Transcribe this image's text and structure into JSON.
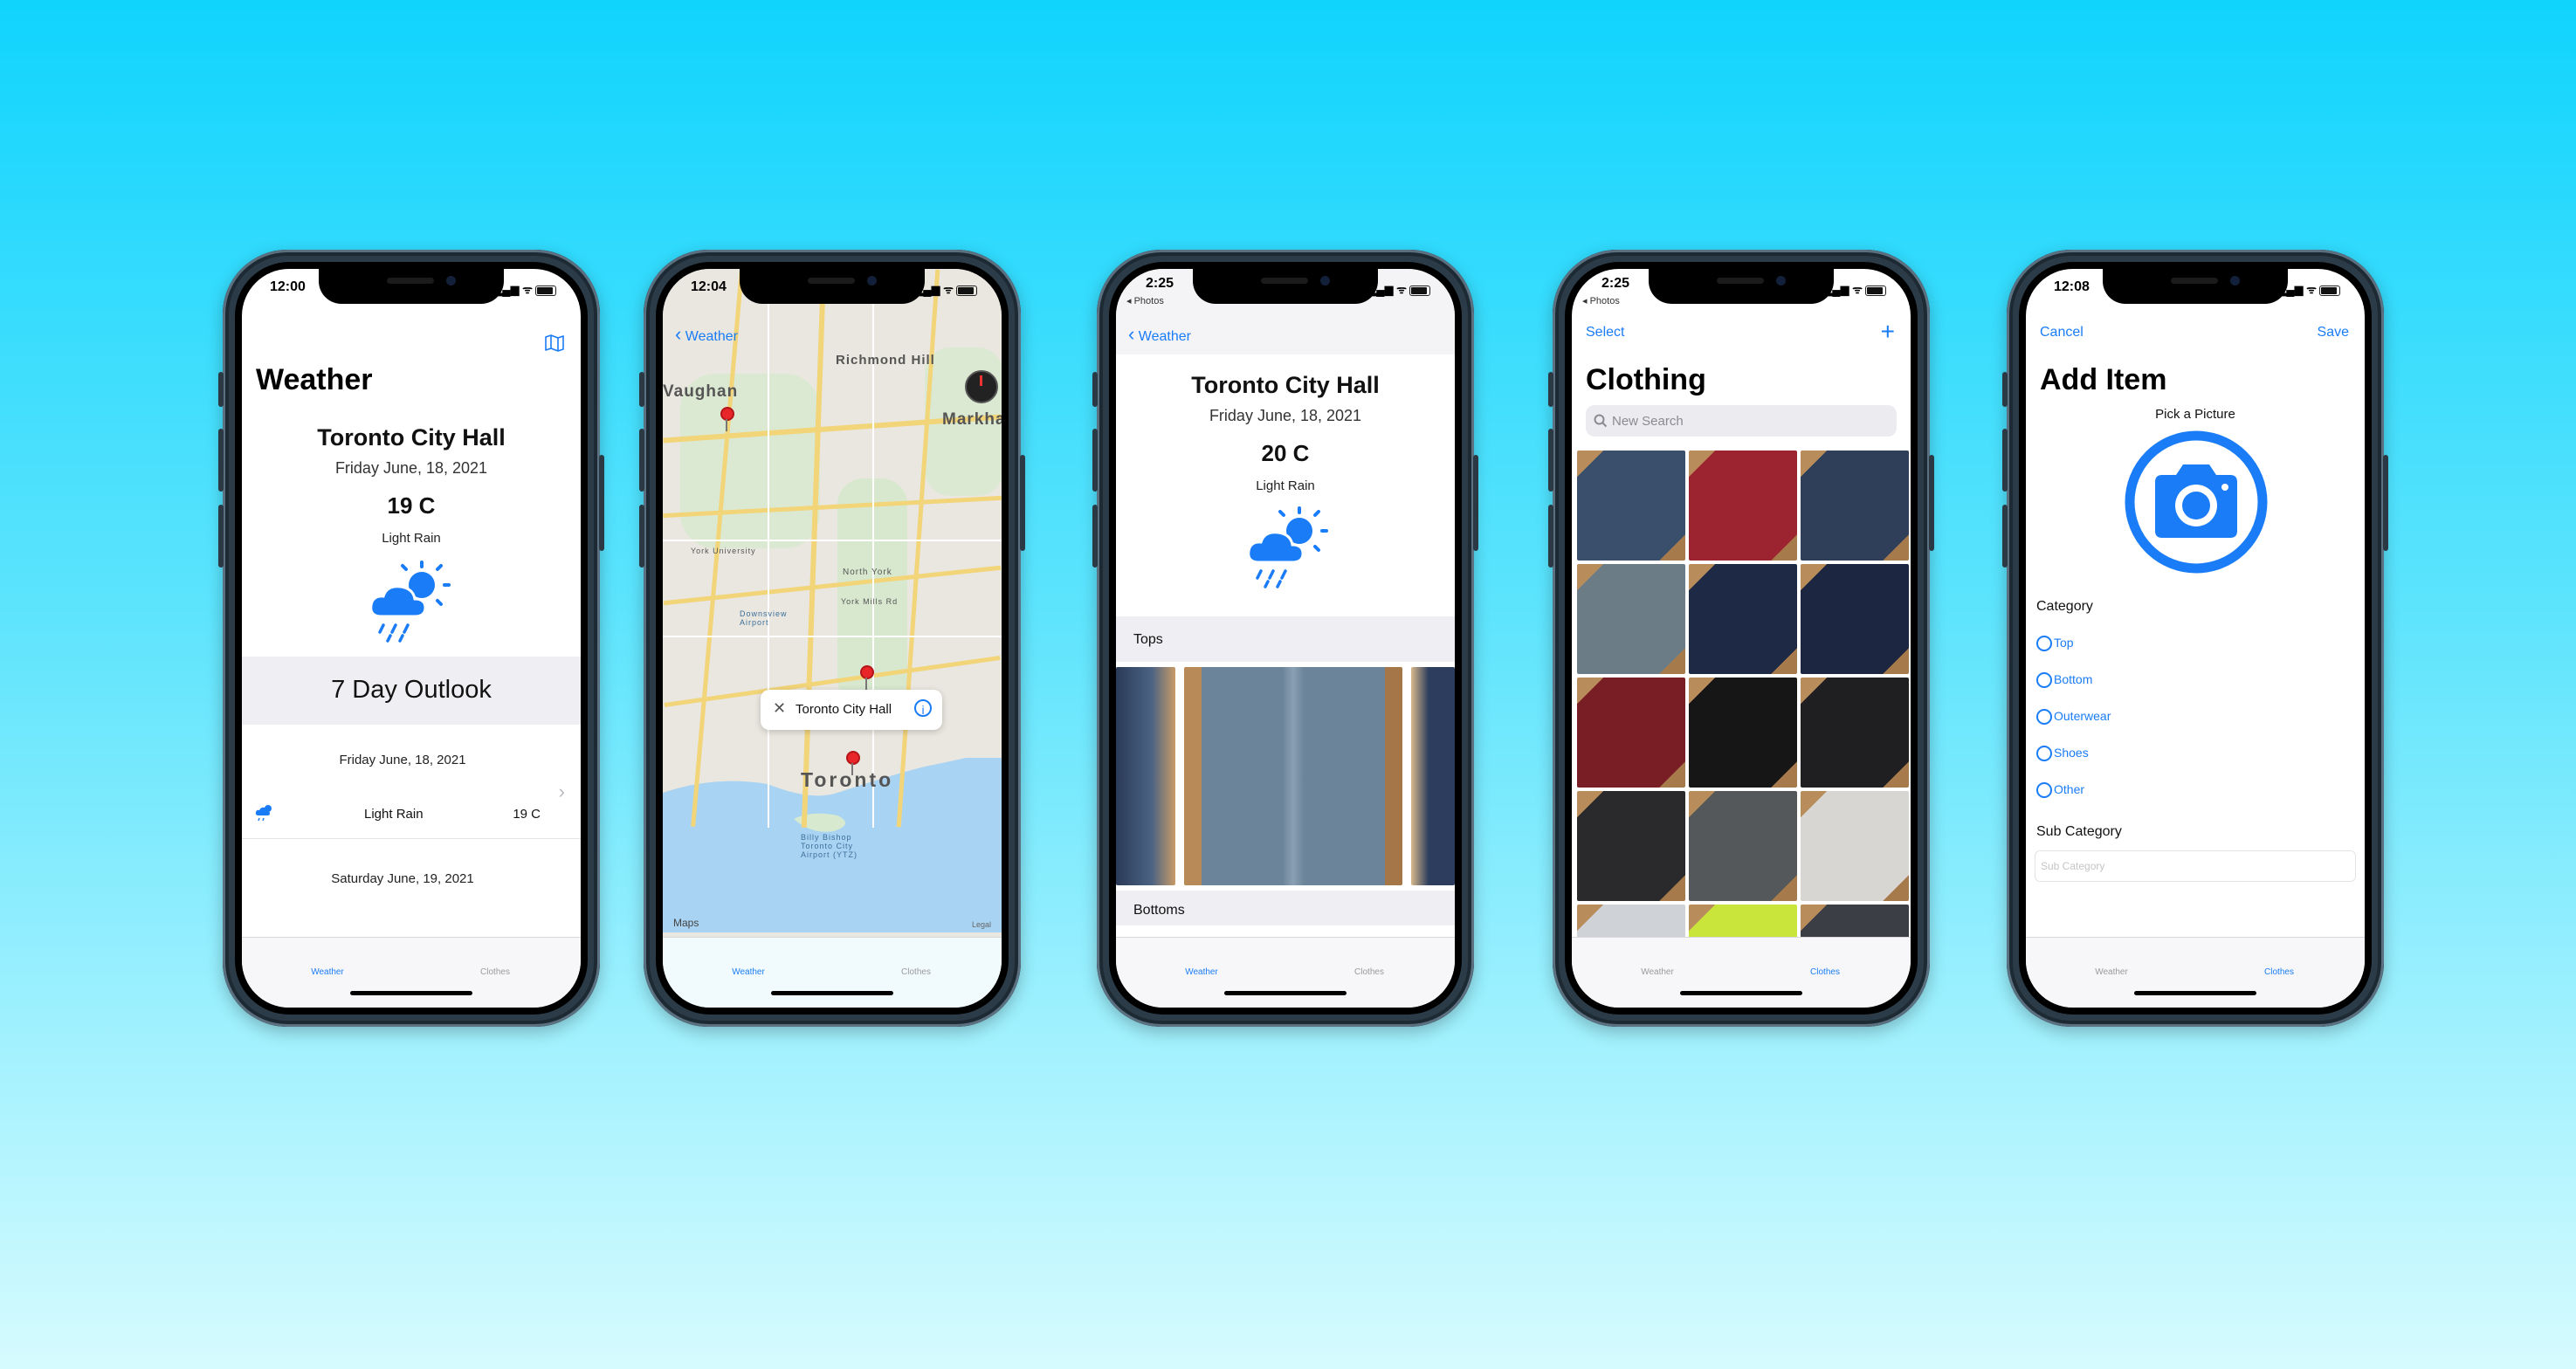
{
  "phone1": {
    "time": "12:00",
    "title": "Weather",
    "location": "Toronto City Hall",
    "date": "Friday June, 18, 2021",
    "temp": "19 C",
    "condition": "Light Rain",
    "outlook_title": "7 Day Outlook",
    "row1_date": "Friday June, 18, 2021",
    "row1_condition": "Light Rain",
    "row1_temp": "19 C",
    "row2_date": "Saturday June, 19, 2021",
    "tab_weather": "Weather",
    "tab_clothes": "Clothes",
    "map_icon": "map-icon"
  },
  "phone2": {
    "time": "12:04",
    "back": "Weather",
    "callout": "Toronto City Hall",
    "labels": {
      "richmond_hill": "Richmond Hill",
      "vaughan": "Vaughan",
      "markham": "Markham",
      "toronto": "Toronto",
      "york_university": "York University",
      "downsview": "Downsview Airport",
      "north_york": "North York",
      "york_mills": "York Mills Rd",
      "bishop": "Billy Bishop Toronto City Airport (YTZ)",
      "maps": "Maps",
      "legal": "Legal"
    },
    "tab_weather": "Weather",
    "tab_clothes": "Clothes"
  },
  "phone3": {
    "time": "2:25",
    "back_app": "◂ Photos",
    "back": "Weather",
    "location": "Toronto City Hall",
    "date": "Friday June, 18, 2021",
    "temp": "20 C",
    "condition": "Light Rain",
    "section_tops": "Tops",
    "section_bottoms": "Bottoms",
    "tab_weather": "Weather",
    "tab_clothes": "Clothes"
  },
  "phone4": {
    "time": "2:25",
    "back_app": "◂ Photos",
    "select": "Select",
    "add": "+",
    "title": "Clothing",
    "search_placeholder": "New Search",
    "tab_weather": "Weather",
    "tab_clothes": "Clothes",
    "colors": [
      "#3a4f6c",
      "#9c2430",
      "#2f3f5a",
      "#6b7c86",
      "#1e2a45",
      "#1c2640",
      "#7a1e26",
      "#161616",
      "#1f1f22",
      "#2a2a2c",
      "#55585b",
      "#d8d6d3",
      "#cfd3d8",
      "#c9e43a",
      "#3b3f45"
    ]
  },
  "phone5": {
    "time": "12:08",
    "cancel": "Cancel",
    "save": "Save",
    "title": "Add Item",
    "pick": "Pick a Picture",
    "category_label": "Category",
    "options": [
      "Top",
      "Bottom",
      "Outerwear",
      "Shoes",
      "Other"
    ],
    "subcategory_label": "Sub Category",
    "subcategory_placeholder": "Sub Category",
    "tab_weather": "Weather",
    "tab_clothes": "Clothes"
  },
  "accent": "#1a7cf6"
}
